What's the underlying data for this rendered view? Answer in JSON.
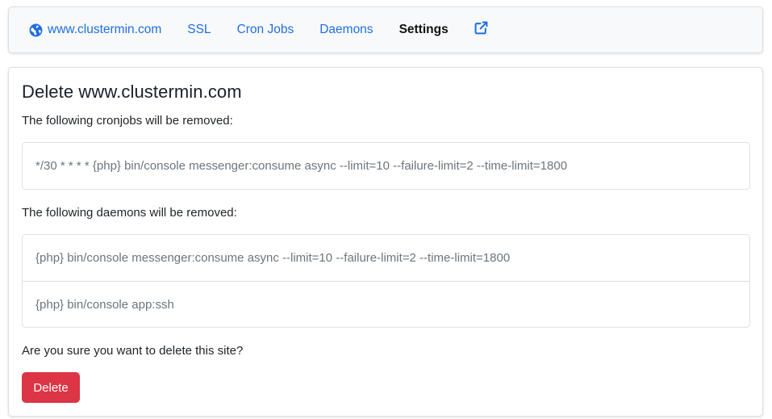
{
  "nav": {
    "items": [
      {
        "label": "www.clustermin.com",
        "icon": "globe-icon",
        "active": false
      },
      {
        "label": "SSL",
        "active": false
      },
      {
        "label": "Cron Jobs",
        "active": false
      },
      {
        "label": "Daemons",
        "active": false
      },
      {
        "label": "Settings",
        "active": true
      }
    ],
    "external_icon": "external-link-icon"
  },
  "main": {
    "title": "Delete www.clustermin.com",
    "cron_intro": "The following cronjobs will be removed:",
    "cronjobs": [
      "*/30 * * * * {php} bin/console messenger:consume async --limit=10 --failure-limit=2 --time-limit=1800"
    ],
    "daemon_intro": "The following daemons will be removed:",
    "daemons": [
      "{php} bin/console messenger:consume async --limit=10 --failure-limit=2 --time-limit=1800",
      "{php} bin/console app:ssh"
    ],
    "confirm_text": "Are you sure you want to delete this site?",
    "delete_label": "Delete"
  },
  "colors": {
    "link": "#1f6fe0",
    "danger": "#dc3545",
    "muted": "#6c757d"
  }
}
